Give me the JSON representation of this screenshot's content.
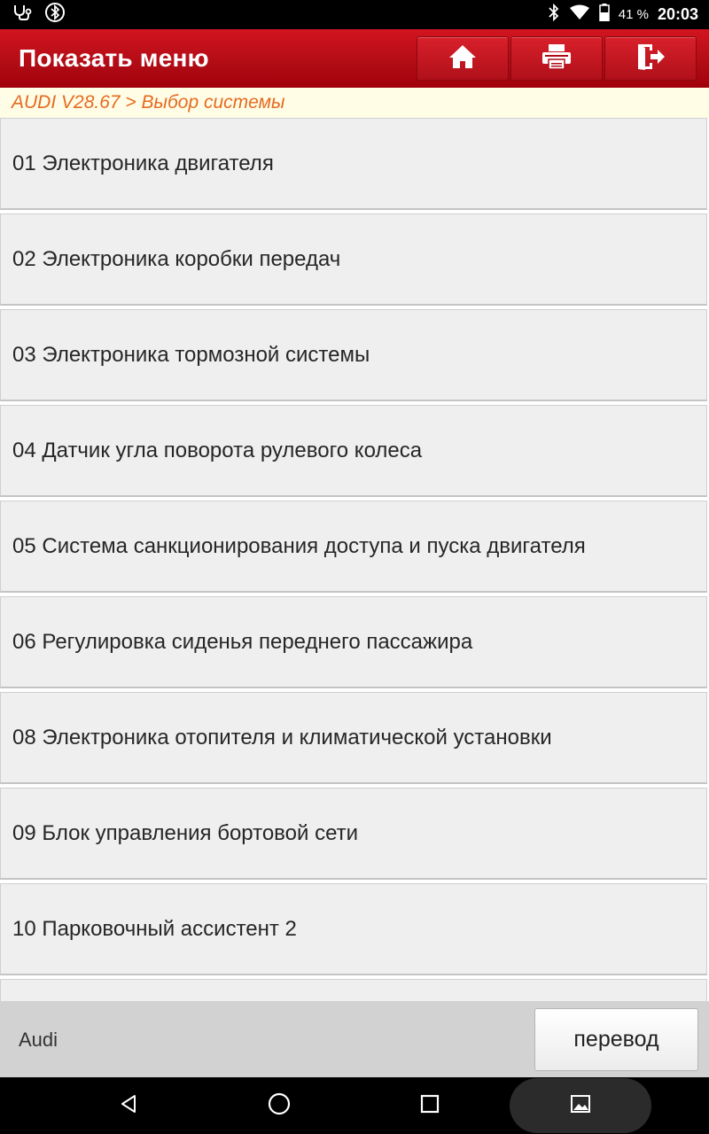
{
  "status_bar": {
    "battery_percent": "41 %",
    "time": "20:03",
    "icons": [
      "stethoscope-icon",
      "bluetooth-circle-icon",
      "bluetooth-icon",
      "wifi-icon",
      "battery-icon"
    ]
  },
  "header": {
    "title": "Показать меню",
    "buttons": [
      "home-icon",
      "print-icon",
      "exit-icon"
    ],
    "accent_color": "#c0101a"
  },
  "breadcrumb": "AUDI V28.67 > Выбор системы",
  "systems": [
    "01 Электроника двигателя",
    "02 Электроника коробки передач",
    "03 Электроника тормозной системы",
    "04 Датчик угла поворота рулевого колеса",
    "05 Система санкционирования доступа и пуска двигателя",
    "06 Регулировка сиденья переднего пассажира",
    "08 Электроника отопителя и климатической установки",
    "09 Блок управления бортовой сети",
    "10 Парковочный ассистент 2",
    ""
  ],
  "bottom_bar": {
    "label": "Audi",
    "translate_button": "перевод"
  },
  "nav_bar": {
    "buttons": [
      "back-icon",
      "home-circle-icon",
      "recent-apps-icon",
      "screenshot-icon"
    ]
  }
}
